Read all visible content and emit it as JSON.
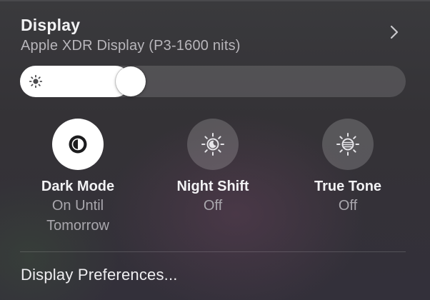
{
  "display": {
    "title": "Display",
    "subtitle": "Apple XDR Display (P3-1600 nits)",
    "chevron_icon": "chevron-right-icon"
  },
  "brightness": {
    "icon": "sun-icon",
    "level_fraction": 0.27
  },
  "toggles": [
    {
      "id": "dark-mode",
      "label": "Dark Mode",
      "status": "On Until\nTomorrow",
      "state": "on",
      "icon": "dark-mode-icon"
    },
    {
      "id": "night-shift",
      "label": "Night Shift",
      "status": "Off",
      "state": "off",
      "icon": "night-shift-icon"
    },
    {
      "id": "true-tone",
      "label": "True Tone",
      "status": "Off",
      "state": "off",
      "icon": "true-tone-icon"
    }
  ],
  "footer": {
    "preferences_label": "Display Preferences..."
  },
  "colors": {
    "toggle_on": "#ffffff",
    "toggle_off": "#5a5860",
    "primary_text": "#f2f2f4",
    "secondary_text": "#a9a7ad"
  }
}
